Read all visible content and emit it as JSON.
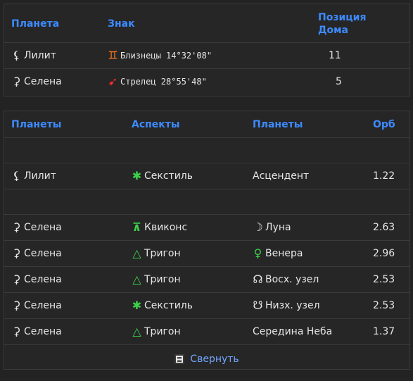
{
  "positions_table": {
    "headers": {
      "planet": "Планета",
      "sign": "Знак",
      "house_line1": "Позиция",
      "house_line2": "Дома"
    },
    "rows": [
      {
        "planet": "Лилит",
        "planet_icon": "lilith-icon",
        "sign_text": "Близнецы 14°32'08\"",
        "sign_icon": "gemini-icon",
        "house": "11"
      },
      {
        "planet": "Селена",
        "planet_icon": "selena-icon",
        "sign_text": "Стрелец 28°55'48\"",
        "sign_icon": "sagittarius-icon",
        "house": "5"
      }
    ]
  },
  "aspects_table": {
    "headers": {
      "planets1": "Планеты",
      "aspects": "Аспекты",
      "planets2": "Планеты",
      "orb": "Орб"
    },
    "rows": [
      {
        "planet1": "Лилит",
        "aspect": "Секстиль",
        "aspect_icon": "sextile-icon",
        "planet2": "Асцендент",
        "planet2_icon": "",
        "orb": "1.22"
      },
      {
        "planet1": "Селена",
        "aspect": "Квиконс",
        "aspect_icon": "quincunx-icon",
        "planet2": "Луна",
        "planet2_icon": "moon-icon",
        "orb": "2.63"
      },
      {
        "planet1": "Селена",
        "aspect": "Тригон",
        "aspect_icon": "trine-icon",
        "planet2": "Венера",
        "planet2_icon": "venus-icon",
        "orb": "2.96"
      },
      {
        "planet1": "Селена",
        "aspect": "Тригон",
        "aspect_icon": "trine-icon",
        "planet2": "Восх. узел",
        "planet2_icon": "north-node-icon",
        "orb": "2.53"
      },
      {
        "planet1": "Селена",
        "aspect": "Секстиль",
        "aspect_icon": "sextile-icon",
        "planet2": "Низх. узел",
        "planet2_icon": "south-node-icon",
        "orb": "2.53"
      },
      {
        "planet1": "Селена",
        "aspect": "Тригон",
        "aspect_icon": "trine-icon",
        "planet2": "Середина Неба",
        "planet2_icon": "",
        "orb": "1.37"
      }
    ],
    "collapse_label": "Свернуть"
  },
  "colors": {
    "header_text": "#3d8bff",
    "aspect_icon": "#3cd24a",
    "gemini_icon": "#ff7a1a",
    "sagittarius_icon": "#ff2a2a",
    "link": "#72a7ff"
  }
}
